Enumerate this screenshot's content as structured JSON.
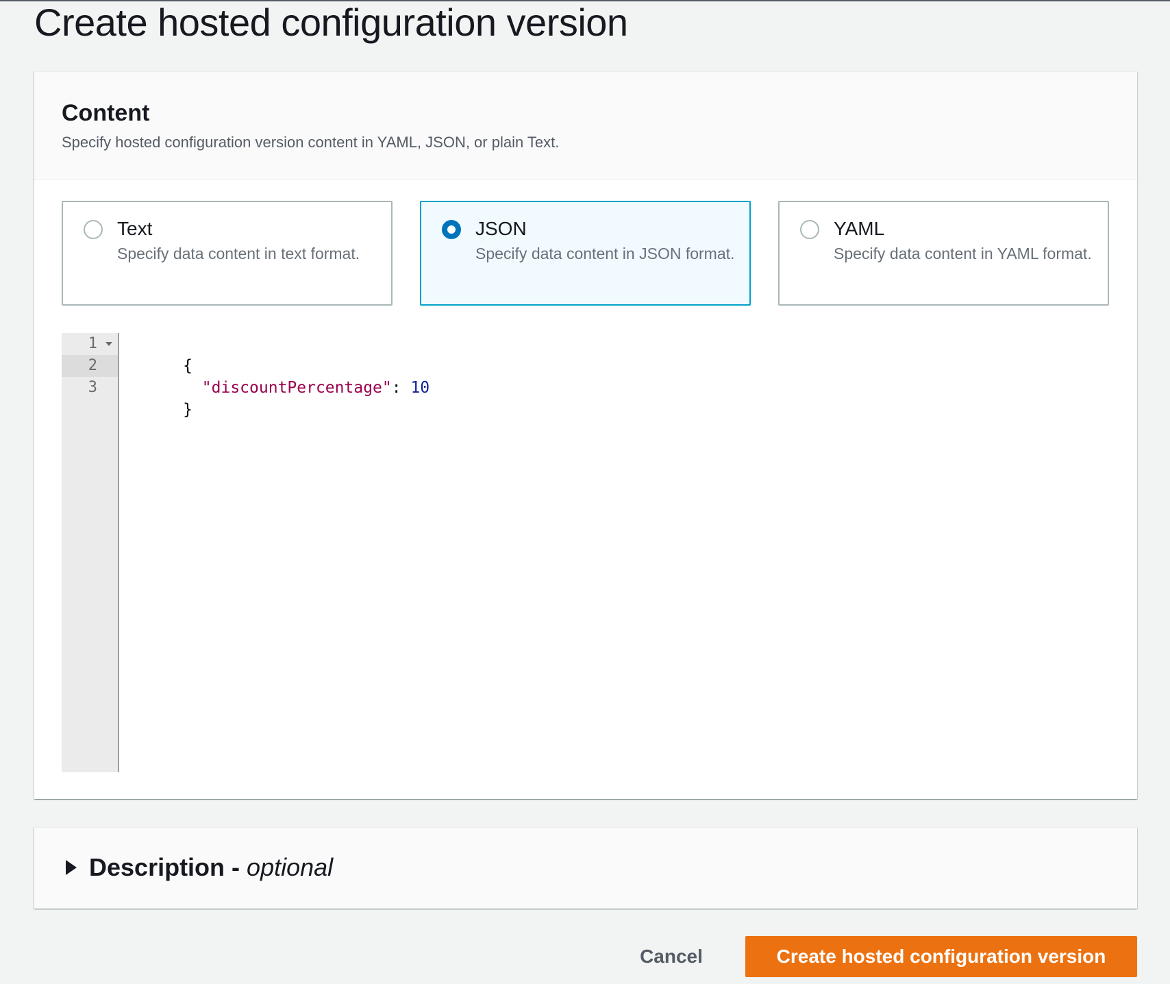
{
  "page": {
    "title": "Create hosted configuration version"
  },
  "content_panel": {
    "title": "Content",
    "description": "Specify hosted configuration version content in YAML, JSON, or plain Text.",
    "format_options": [
      {
        "label": "Text",
        "description": "Specify data content in text format.",
        "selected": false
      },
      {
        "label": "JSON",
        "description": "Specify data content in JSON format.",
        "selected": true
      },
      {
        "label": "YAML",
        "description": "Specify data content in YAML format.",
        "selected": false
      }
    ]
  },
  "editor": {
    "line_numbers": [
      "1",
      "2",
      "3"
    ],
    "active_line": 2,
    "lines": {
      "l1_brace": "{",
      "l2_indent": "  ",
      "l2_key": "\"discountPercentage\"",
      "l2_colon": ": ",
      "l2_value": "10",
      "l3_brace": "}"
    }
  },
  "description_panel": {
    "title": "Description -",
    "optional": "optional"
  },
  "actions": {
    "cancel_label": "Cancel",
    "submit_label": "Create hosted configuration version"
  },
  "colors": {
    "primary_button": "#ec7211",
    "selected_tile_border": "#00a1c9",
    "selected_tile_bg": "#f1faff",
    "radio_selected": "#0073bb",
    "json_key": "#99004d",
    "json_number": "#0f1f99"
  }
}
